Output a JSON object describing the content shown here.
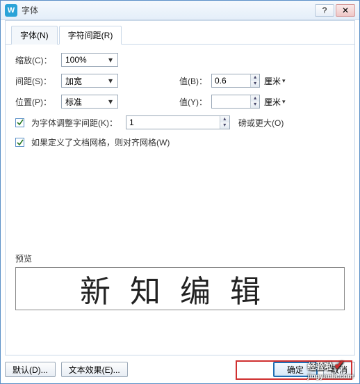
{
  "window": {
    "title": "字体"
  },
  "tabs": {
    "font": "字体(N)",
    "spacing": "字符间距(R)"
  },
  "rows": {
    "zoom_label": "缩放(C)：",
    "zoom_value": "100%",
    "spacing_label": "间距(S)：",
    "spacing_value": "加宽",
    "position_label": "位置(P)：",
    "position_value": "标准",
    "value_b_label": "值(B)：",
    "value_b": "0.6",
    "value_b_unit": "厘米",
    "value_y_label": "值(Y)：",
    "value_y": "",
    "value_y_unit": "厘米",
    "kerning_cb": "为字体调整字间距(K)：",
    "kerning_value": "1",
    "kerning_unit": "磅或更大(O)",
    "grid_cb": "如果定义了文档网格，则对齐网格(W)"
  },
  "preview": {
    "label": "预览",
    "text": "新知编辑"
  },
  "footer": {
    "default": "默认(D)...",
    "text_effects": "文本效果(E)...",
    "ok": "确定",
    "cancel": "取消"
  },
  "watermark": {
    "main": "经验啦",
    "sub": "jingyanla.com"
  }
}
